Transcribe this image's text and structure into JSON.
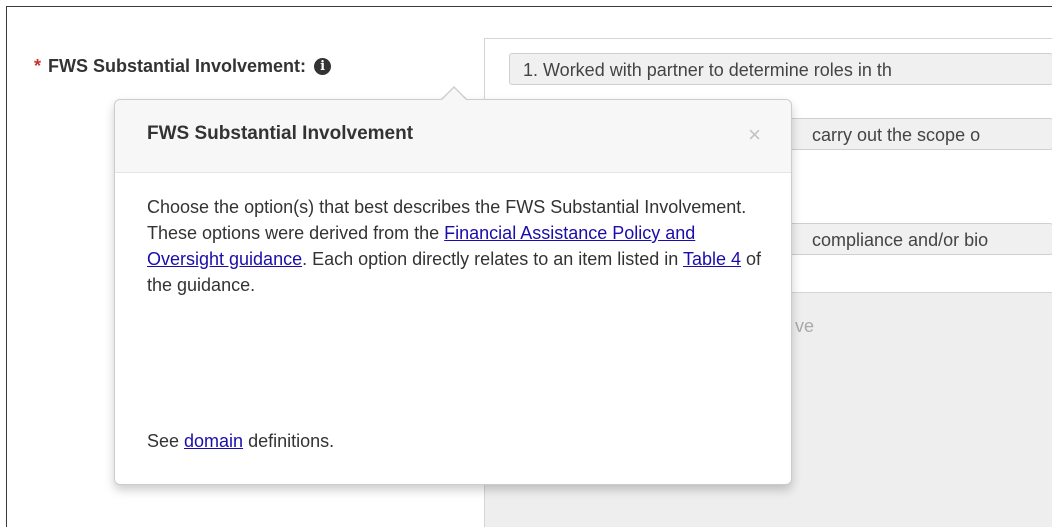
{
  "field": {
    "required_mark": "*",
    "label": "FWS Substantial Involvement:",
    "info_icon": "info-circle-icon"
  },
  "selections": [
    "1. Worked with partner to determine roles in th",
    "carry out the scope o",
    "compliance and/or bio"
  ],
  "search_placeholder": "ve",
  "popover": {
    "title": "FWS Substantial Involvement",
    "close_label": "×",
    "body": {
      "text1": "Choose the option(s) that best describes the FWS Substantial Involvement. These options were derived from the ",
      "link1": "Financial Assistance Policy and Oversight guidance",
      "text2": ". Each option directly relates to an item listed in ",
      "link2": "Table 4",
      "text3": " of the guidance."
    },
    "footer": {
      "text1": "See ",
      "link": "domain",
      "text2": " definitions."
    }
  }
}
